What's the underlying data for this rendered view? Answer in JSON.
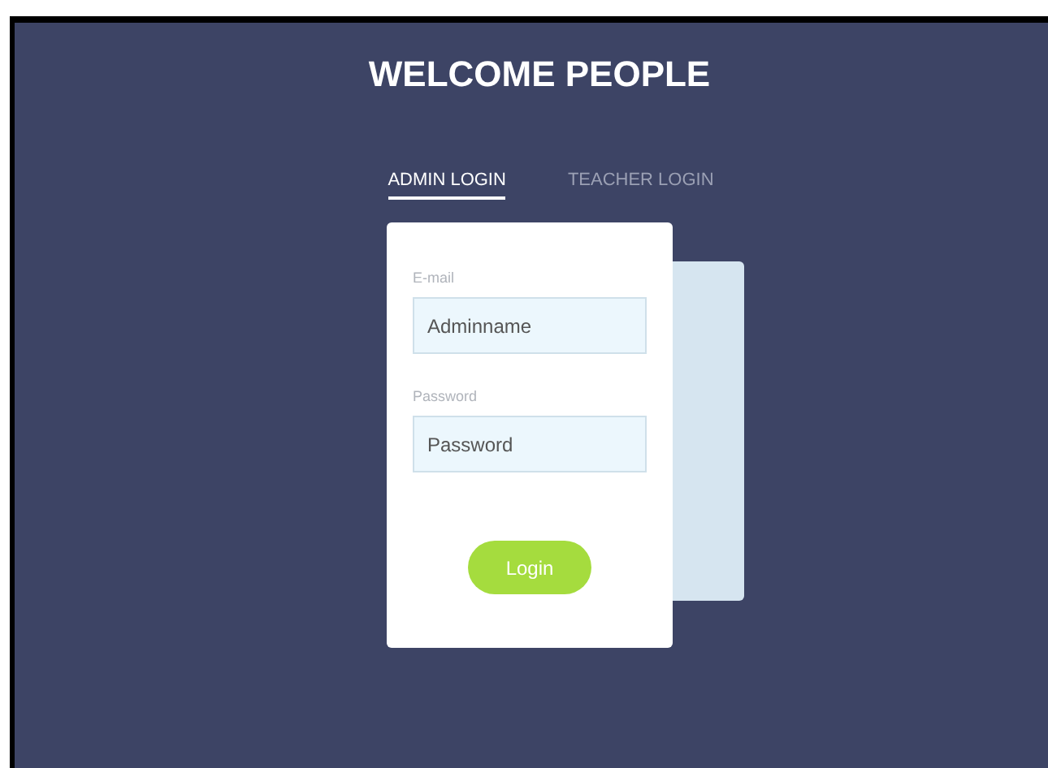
{
  "title": "WELCOME PEOPLE",
  "tabs": [
    {
      "label": "ADMIN LOGIN",
      "selected": true
    },
    {
      "label": "TEACHER LOGIN",
      "selected": false
    }
  ],
  "form": {
    "fields": [
      {
        "label": "E-mail",
        "placeholder": "Adminname"
      },
      {
        "label": "Password",
        "placeholder": "Password"
      }
    ],
    "button": "Login"
  }
}
